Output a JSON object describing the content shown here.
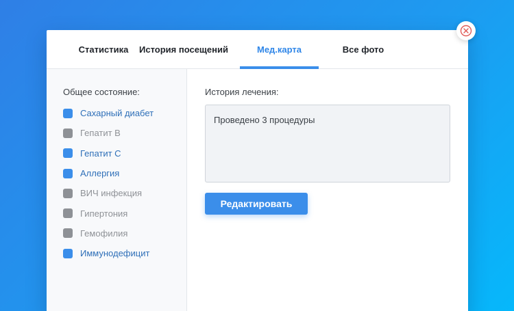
{
  "tabs": [
    {
      "label": "Статистика"
    },
    {
      "label": "История посещений"
    },
    {
      "label": "Мед.карта",
      "active": true
    },
    {
      "label": "Все фото"
    }
  ],
  "sidebar": {
    "title": "Общее состояние:",
    "conditions": [
      {
        "label": "Сахарный диабет",
        "checked": true
      },
      {
        "label": "Гепатит В",
        "checked": false
      },
      {
        "label": "Гепатит С",
        "checked": true
      },
      {
        "label": "Аллергия",
        "checked": true
      },
      {
        "label": "ВИЧ инфекция",
        "checked": false
      },
      {
        "label": "Гипертония",
        "checked": false
      },
      {
        "label": "Гемофилия",
        "checked": false
      },
      {
        "label": "Иммунодефицит",
        "checked": true
      }
    ]
  },
  "main": {
    "history_label": "История лечения:",
    "history_text": "Проведено 3 процедуры",
    "edit_label": "Редактировать"
  },
  "colors": {
    "accent": "#3b8eea",
    "checked_text": "#2e6fb8",
    "unchecked": "#8e9196",
    "close_icon": "#e05a57"
  },
  "icons": {
    "close": "close-circle-icon"
  }
}
